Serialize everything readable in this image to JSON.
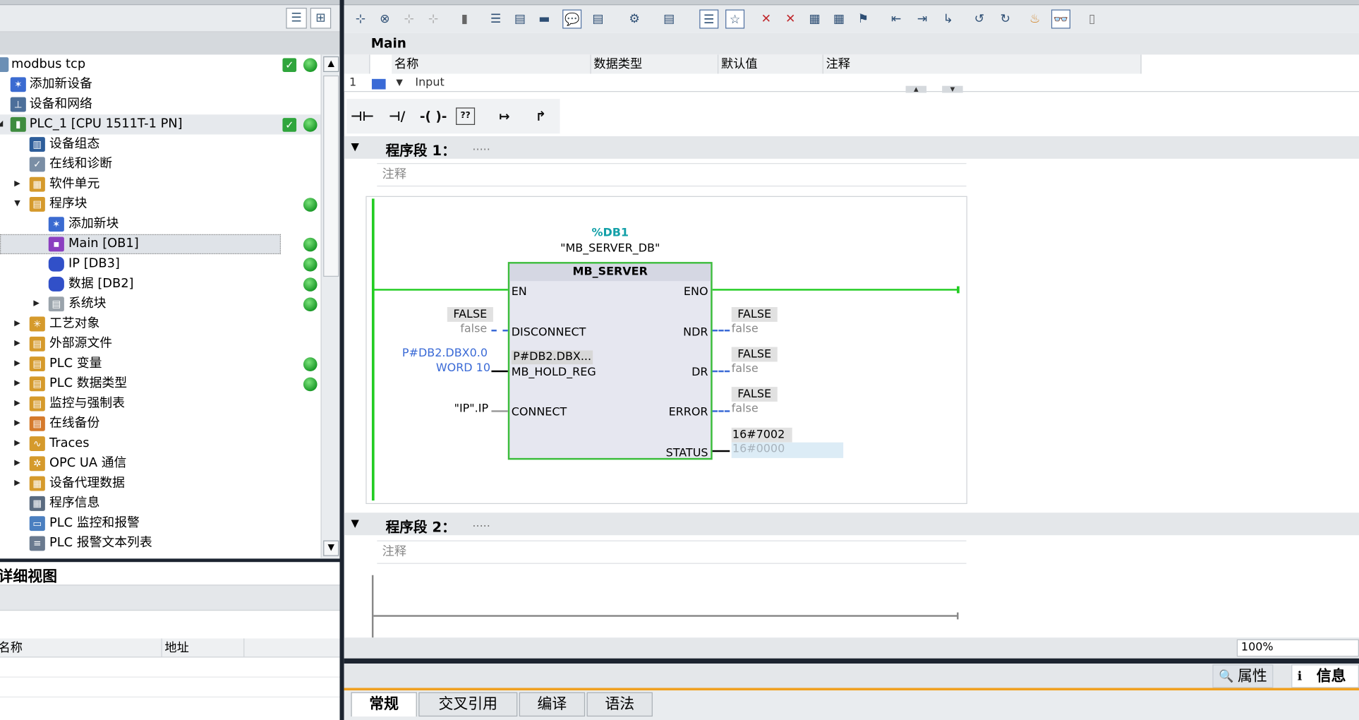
{
  "project": {
    "root": "modbus tcp",
    "add_device": "添加新设备",
    "devices_networks": "设备和网络",
    "plc": "PLC_1 [CPU 1511T-1 PN]",
    "device_config": "设备组态",
    "online_diag": "在线和诊断",
    "software_units": "软件单元",
    "program_blocks": "程序块",
    "add_block": "添加新块",
    "main_ob": "Main [OB1]",
    "ip_db": "IP [DB3]",
    "data_db": "数据 [DB2]",
    "system_blocks": "系统块",
    "tech_objects": "工艺对象",
    "external_sources": "外部源文件",
    "plc_tags": "PLC 变量",
    "plc_datatypes": "PLC 数据类型",
    "watch_force": "监控与强制表",
    "online_backup": "在线备份",
    "traces": "Traces",
    "opcua": "OPC UA 通信",
    "proxy_data": "设备代理数据",
    "program_info": "程序信息",
    "plc_alarms": "PLC 监控和报警",
    "plc_alarm_text": "PLC 报警文本列表"
  },
  "detail": {
    "title": "详细视图",
    "col_name": "名称",
    "col_address": "地址"
  },
  "editor": {
    "block_name": "Main",
    "iface_cols": [
      "名称",
      "数据类型",
      "默认值",
      "注释"
    ],
    "iface_row_num": "1",
    "iface_row_name": "Input",
    "lad_elems": [
      "⊣⊢",
      "⊣/⊢",
      "-( )-",
      "??",
      "↦",
      "↱"
    ],
    "zoom": "100%"
  },
  "networks": [
    {
      "title": "程序段 1：",
      "dots": ".....",
      "comment": "注释"
    },
    {
      "title": "程序段 2：",
      "dots": ".....",
      "comment": "注释"
    }
  ],
  "fb": {
    "instance_addr": "%DB1",
    "instance_name": "\"MB_SERVER_DB\"",
    "type": "MB_SERVER",
    "en": "EN",
    "eno": "ENO",
    "disconnect": "DISCONNECT",
    "mb_hold_reg": "MB_HOLD_REG",
    "connect": "CONNECT",
    "ndr": "NDR",
    "dr": "DR",
    "error": "ERROR",
    "status": "STATUS",
    "disconnect_live": "FALSE",
    "disconnect_op": "false",
    "hold_reg_op1": "P#DB2.DBX0.0",
    "hold_reg_op2": "WORD 10",
    "hold_reg_live": "P#DB2.DBX...",
    "connect_op": "\"IP\".IP",
    "ndr_live": "FALSE",
    "ndr_op": "false",
    "dr_live": "FALSE",
    "dr_op": "false",
    "error_live": "FALSE",
    "error_op": "false",
    "status_live": "16#7002",
    "status_op": "16#0000"
  },
  "inspector": {
    "properties": "属性",
    "info": "信息",
    "tabs": [
      "常规",
      "交叉引用",
      "编译",
      "语法"
    ]
  },
  "colors": {
    "power_rail": "#22cc22",
    "status_ok": "#2fa53c",
    "accent_orange": "#f0a020",
    "op_blue": "#3a6ad6"
  }
}
